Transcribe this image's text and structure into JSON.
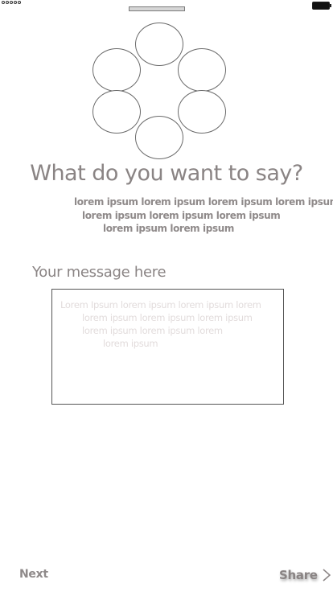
{
  "title": "What do you want to say?",
  "subtitle": [
    "lorem ipsum lorem ipsum lorem ipsum lorem ipsum",
    "lorem ipsum lorem ipsum lorem ipsum",
    "lorem ipsum lorem ipsum"
  ],
  "message": {
    "label": "Your message here",
    "placeholder": [
      "Lorem Ipsum lorem ipsum lorem ipsum lorem",
      "lorem ipsum lorem ipsum lorem ipsum",
      "lorem ipsum lorem ipsum lorem",
      "lorem ipsum"
    ]
  },
  "footer": {
    "next_label": "Next",
    "share_label": "Share"
  },
  "icons": {
    "signal": "signal-dots-icon",
    "battery": "battery-icon",
    "share": "chevron-right-icon"
  },
  "colors": {
    "text": "#8a8484",
    "placeholder": "#e2dcdc",
    "outline": "#6a6a6a"
  }
}
